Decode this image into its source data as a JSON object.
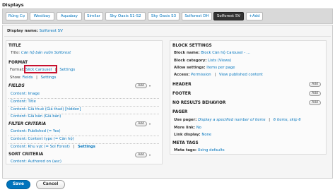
{
  "heading": "Displays",
  "tabs": [
    "Rừng Cọ",
    "Westbay",
    "Aquabay",
    "Similar",
    "Sky Oasis S1-S2",
    "Sky Oasis S3",
    "Solforest DH",
    "Solforest SV",
    "+Add"
  ],
  "display_name": {
    "label": "Display name:",
    "value": "Solforest SV"
  },
  "left": {
    "title_section": "TITLE",
    "title_row": {
      "label": "Title:",
      "value": "Căn hộ bán vườn Solforest"
    },
    "format_section": "FORMAT",
    "format_row": {
      "label": "Format:",
      "value": "Slick Carousel",
      "sep": "|",
      "settings": "Settings"
    },
    "show_row": {
      "label": "Show:",
      "value": "Fields",
      "sep": "|",
      "settings": "Settings"
    },
    "fields_section": "FIELDS",
    "fields": [
      "Content: Image",
      "Content: Title",
      "Content: Giá thuê (Giá thuê) [hidden]",
      "Content: Giá bán (Giá bán)"
    ],
    "filter_section": "FILTER CRITERIA",
    "filters": [
      "Content: Published (= Yes)",
      "Content: Content type (= Căn hộ)"
    ],
    "filter_last": {
      "value": "Content: Khu vực (= Sol Forest)",
      "sep": "|",
      "settings": "Settings"
    },
    "sort_section": "SORT CRITERIA",
    "sorts": [
      "Content: Authored on (asc)"
    ]
  },
  "right": {
    "block_settings_section": "BLOCK SETTINGS",
    "block_name": {
      "label": "Block name:",
      "value": "Block Căn hộ Carousel - ..."
    },
    "block_category": {
      "label": "Block category:",
      "value": "Lists (Views)"
    },
    "allow_settings": {
      "label": "Allow settings:",
      "value": "Items per page"
    },
    "access": {
      "label": "Access:",
      "value": "Permission",
      "sep": "|",
      "extra": "View published content"
    },
    "header_section": "HEADER",
    "footer_section": "FOOTER",
    "no_results_section": "NO RESULTS BEHAVIOR",
    "pager_section": "PAGER",
    "use_pager": {
      "label": "Use pager:",
      "value": "Display a specified number of items",
      "sep": "|",
      "extra": "6 items, skip 6"
    },
    "more_link": {
      "label": "More link:",
      "value": "No"
    },
    "link_display": {
      "label": "Link display:",
      "value": "None"
    },
    "meta_tags_section": "META TAGS",
    "meta_tags": {
      "label": "Meta tags:",
      "value": "Using defaults"
    }
  },
  "add_label": "Add",
  "buttons": {
    "save": "Save",
    "cancel": "Cancel"
  },
  "colors": {
    "link": "#0074bd",
    "save_bg": "#0074bd",
    "highlight": "#c8102e",
    "active_tab": "#333333"
  }
}
